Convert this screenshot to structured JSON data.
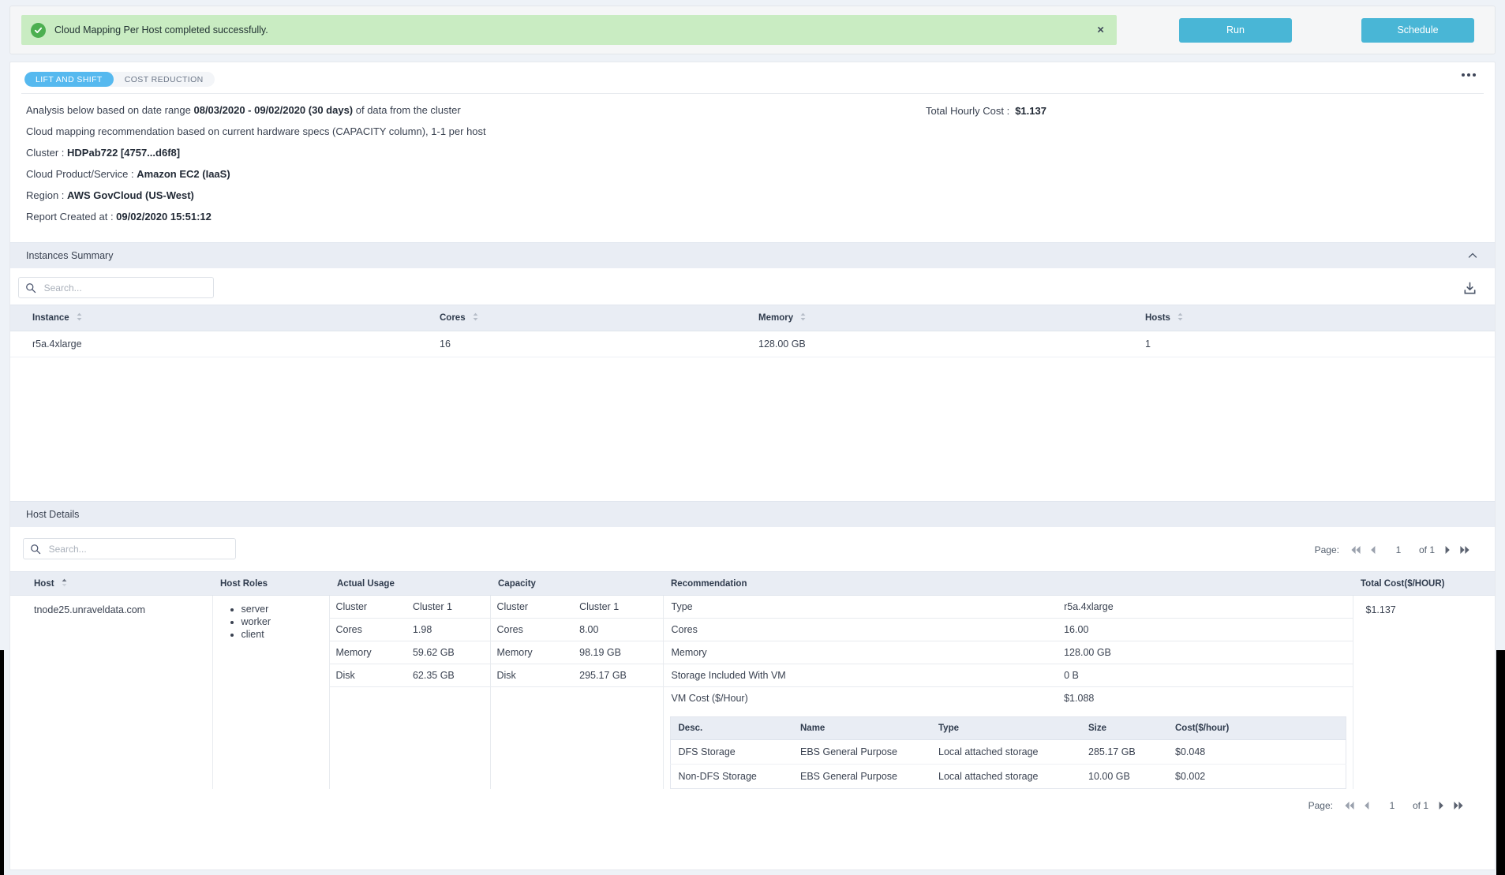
{
  "alert": {
    "icon": "check-circle-icon",
    "message": "Cloud Mapping Per Host completed successfully.",
    "close_label": "×"
  },
  "actions": {
    "run_label": "Run",
    "schedule_label": "Schedule"
  },
  "tabs": [
    {
      "label": "LIFT AND SHIFT",
      "active": true
    },
    {
      "label": "COST REDUCTION",
      "active": false
    }
  ],
  "overflow_menu": "more-options",
  "info": {
    "line1_pre": "Analysis below based on date range ",
    "line1_bold": "08/03/2020 - 09/02/2020 (30 days)",
    "line1_post": " of data from the cluster",
    "line2": "Cloud mapping recommendation based on current hardware specs (CAPACITY column), 1-1 per host",
    "cluster_label": "Cluster : ",
    "cluster_value": "HDPab722 [4757...d6f8]",
    "product_label": "Cloud Product/Service : ",
    "product_value": "Amazon EC2 (IaaS)",
    "region_label": "Region : ",
    "region_value": "AWS GovCloud (US-West)",
    "created_label": "Report Created at : ",
    "created_value": "09/02/2020 15:51:12",
    "total_cost_label": "Total Hourly Cost :",
    "total_cost_value": "$1.137"
  },
  "instances_summary": {
    "title": "Instances Summary",
    "search_placeholder": "Search...",
    "search_value": "",
    "download_label": "download-icon",
    "columns": [
      "Instance",
      "Cores",
      "Memory",
      "Hosts"
    ],
    "rows": [
      {
        "instance": "r5a.4xlarge",
        "cores": "16",
        "memory": "128.00 GB",
        "hosts": "1"
      }
    ]
  },
  "host_details": {
    "title": "Host Details",
    "search_placeholder": "Search...",
    "search_value": "",
    "pager": {
      "label": "Page:",
      "first": "first-page-icon",
      "prev": "prev-page-icon",
      "current": "1",
      "of_total": "of 1",
      "next": "next-page-icon",
      "last": "last-page-icon"
    },
    "columns": [
      "Host",
      "Host Roles",
      "Actual Usage",
      "Capacity",
      "Recommendation",
      "Total Cost($/HOUR)"
    ],
    "row": {
      "host": "tnode25.unraveldata.com",
      "roles": [
        "server",
        "worker",
        "client"
      ],
      "actual_usage": [
        {
          "k": "Cluster",
          "v": "Cluster 1"
        },
        {
          "k": "Cores",
          "v": "1.98"
        },
        {
          "k": "Memory",
          "v": "59.62 GB"
        },
        {
          "k": "Disk",
          "v": "62.35 GB"
        }
      ],
      "capacity": [
        {
          "k": "Cluster",
          "v": "Cluster 1"
        },
        {
          "k": "Cores",
          "v": "8.00"
        },
        {
          "k": "Memory",
          "v": "98.19 GB"
        },
        {
          "k": "Disk",
          "v": "295.17 GB"
        }
      ],
      "recommendation": [
        {
          "k": "Type",
          "v": "r5a.4xlarge"
        },
        {
          "k": "Cores",
          "v": "16.00"
        },
        {
          "k": "Memory",
          "v": "128.00 GB"
        },
        {
          "k": "Storage Included With VM",
          "v": "0 B"
        },
        {
          "k": "VM Cost ($/Hour)",
          "v": "$1.088"
        }
      ],
      "storage_columns": [
        "Desc.",
        "Name",
        "Type",
        "Size",
        "Cost($/hour)"
      ],
      "storage_rows": [
        {
          "desc": "DFS Storage",
          "name": "EBS General Purpose",
          "type": "Local attached storage",
          "size": "285.17 GB",
          "cost": "$0.048"
        },
        {
          "desc": "Non-DFS Storage",
          "name": "EBS General Purpose",
          "type": "Local attached storage",
          "size": "10.00 GB",
          "cost": "$0.002"
        }
      ],
      "total_cost": "$1.137"
    }
  },
  "colors": {
    "accent": "#49b6d6",
    "tab_active": "#56b9ef",
    "success_bg": "#c9ecc2",
    "success_icon": "#4caf50",
    "section_header_bg": "#e9edf4"
  }
}
